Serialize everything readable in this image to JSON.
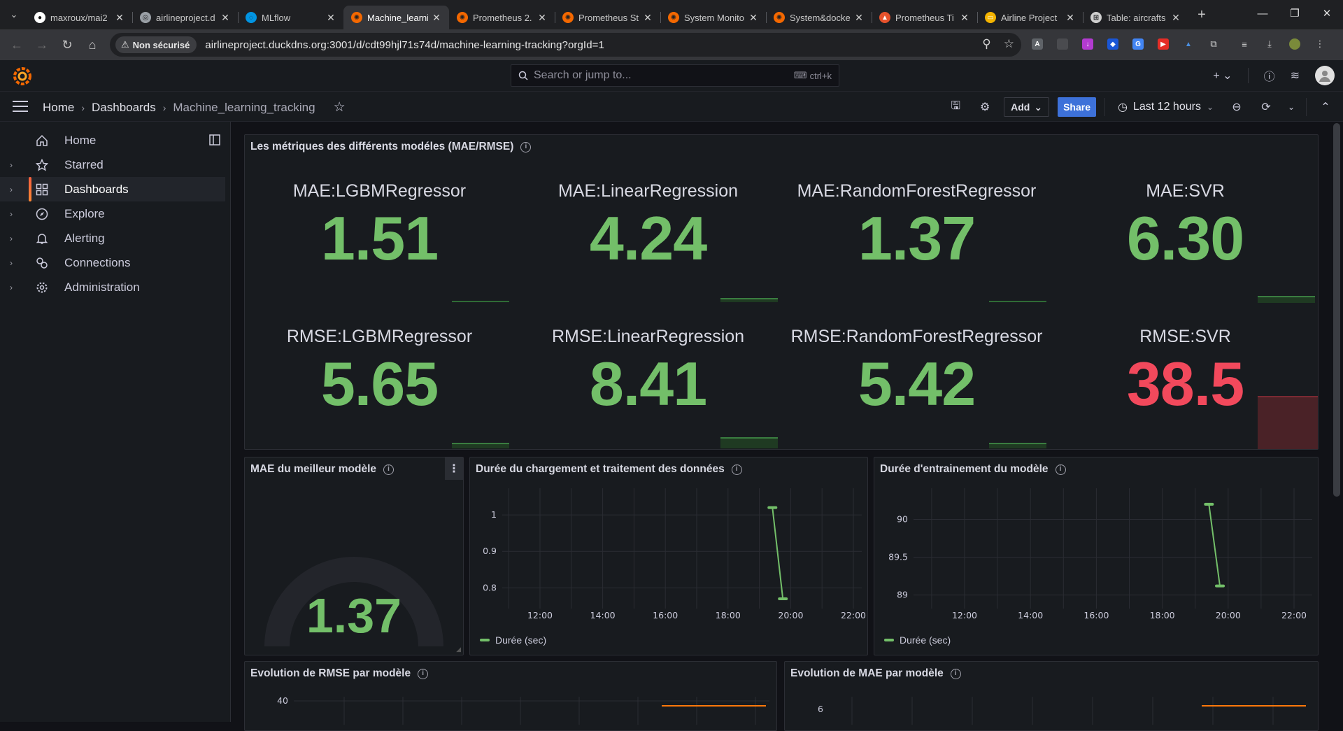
{
  "browser": {
    "tabs": [
      {
        "label": "maxroux/mai2",
        "icon": "github-icon"
      },
      {
        "label": "airlineproject.d",
        "icon": "globe-icon"
      },
      {
        "label": "MLflow",
        "icon": "mlflow-icon"
      },
      {
        "label": "Machine_learni",
        "icon": "grafana-icon",
        "active": true
      },
      {
        "label": "Prometheus 2.",
        "icon": "grafana-icon"
      },
      {
        "label": "Prometheus St",
        "icon": "grafana-icon"
      },
      {
        "label": "System Monito",
        "icon": "grafana-icon"
      },
      {
        "label": "System&docke",
        "icon": "grafana-icon"
      },
      {
        "label": "Prometheus Ti",
        "icon": "prometheus-icon"
      },
      {
        "label": "Airline Project",
        "icon": "slides-icon"
      },
      {
        "label": "Table: aircrafts",
        "icon": "table-icon"
      }
    ],
    "security_label": "Non sécurisé",
    "url": "airlineproject.duckdns.org:3001/d/cdt99hjl71s74d/machine-learning-tracking?orgId=1"
  },
  "grafana": {
    "search_placeholder": "Search or jump to...",
    "search_shortcut": "ctrl+k",
    "breadcrumb": [
      "Home",
      "Dashboards",
      "Machine_learning_tracking"
    ],
    "add_label": "Add",
    "share_label": "Share",
    "time_range": "Last 12 hours"
  },
  "sidebar": {
    "items": [
      {
        "label": "Home",
        "icon": "home-icon"
      },
      {
        "label": "Starred",
        "icon": "star-icon"
      },
      {
        "label": "Dashboards",
        "icon": "dashboards-icon",
        "active": true
      },
      {
        "label": "Explore",
        "icon": "compass-icon"
      },
      {
        "label": "Alerting",
        "icon": "bell-icon"
      },
      {
        "label": "Connections",
        "icon": "connections-icon"
      },
      {
        "label": "Administration",
        "icon": "gear-icon"
      }
    ]
  },
  "panels": {
    "metrics": {
      "title": "Les métriques des différents modéles (MAE/RMSE)",
      "stats": [
        {
          "name": "MAE:LGBMRegressor",
          "value": "1.51",
          "color": "#73bf69"
        },
        {
          "name": "MAE:LinearRegression",
          "value": "4.24",
          "color": "#73bf69"
        },
        {
          "name": "MAE:RandomForestRegressor",
          "value": "1.37",
          "color": "#73bf69"
        },
        {
          "name": "MAE:SVR",
          "value": "6.30",
          "color": "#73bf69"
        },
        {
          "name": "RMSE:LGBMRegressor",
          "value": "5.65",
          "color": "#73bf69"
        },
        {
          "name": "RMSE:LinearRegression",
          "value": "8.41",
          "color": "#73bf69"
        },
        {
          "name": "RMSE:RandomForestRegressor",
          "value": "5.42",
          "color": "#73bf69"
        },
        {
          "name": "RMSE:SVR",
          "value": "38.5",
          "color": "#f2495c"
        }
      ]
    },
    "best_model": {
      "title": "MAE du meilleur modèle",
      "value": "1.37"
    },
    "load_duration": {
      "title": "Durée du chargement et traitement des données",
      "legend": "Durée (sec)"
    },
    "train_duration": {
      "title": "Durée d'entrainement du modèle",
      "legend": "Durée (sec)"
    },
    "rmse_evolution": {
      "title": "Evolution de RMSE par modèle",
      "y_tick": "40"
    },
    "mae_evolution": {
      "title": "Evolution de MAE par modèle",
      "y_tick": "6"
    }
  },
  "chart_data": [
    {
      "type": "line",
      "title": "Durée du chargement et traitement des données",
      "x_ticks": [
        "12:00",
        "14:00",
        "16:00",
        "18:00",
        "20:00",
        "22:00"
      ],
      "y_ticks": [
        "0.8",
        "0.9",
        "1"
      ],
      "series": [
        {
          "name": "Durée (sec)",
          "x": [
            "19:25",
            "19:45"
          ],
          "y": [
            1.02,
            0.77
          ]
        }
      ],
      "color": "#73bf69"
    },
    {
      "type": "line",
      "title": "Durée d'entrainement du modèle",
      "x_ticks": [
        "12:00",
        "14:00",
        "16:00",
        "18:00",
        "20:00",
        "22:00"
      ],
      "y_ticks": [
        "89",
        "89.5",
        "90"
      ],
      "series": [
        {
          "name": "Durée (sec)",
          "x": [
            "19:25",
            "19:45"
          ],
          "y": [
            90.2,
            89.12
          ]
        }
      ],
      "color": "#73bf69"
    }
  ]
}
